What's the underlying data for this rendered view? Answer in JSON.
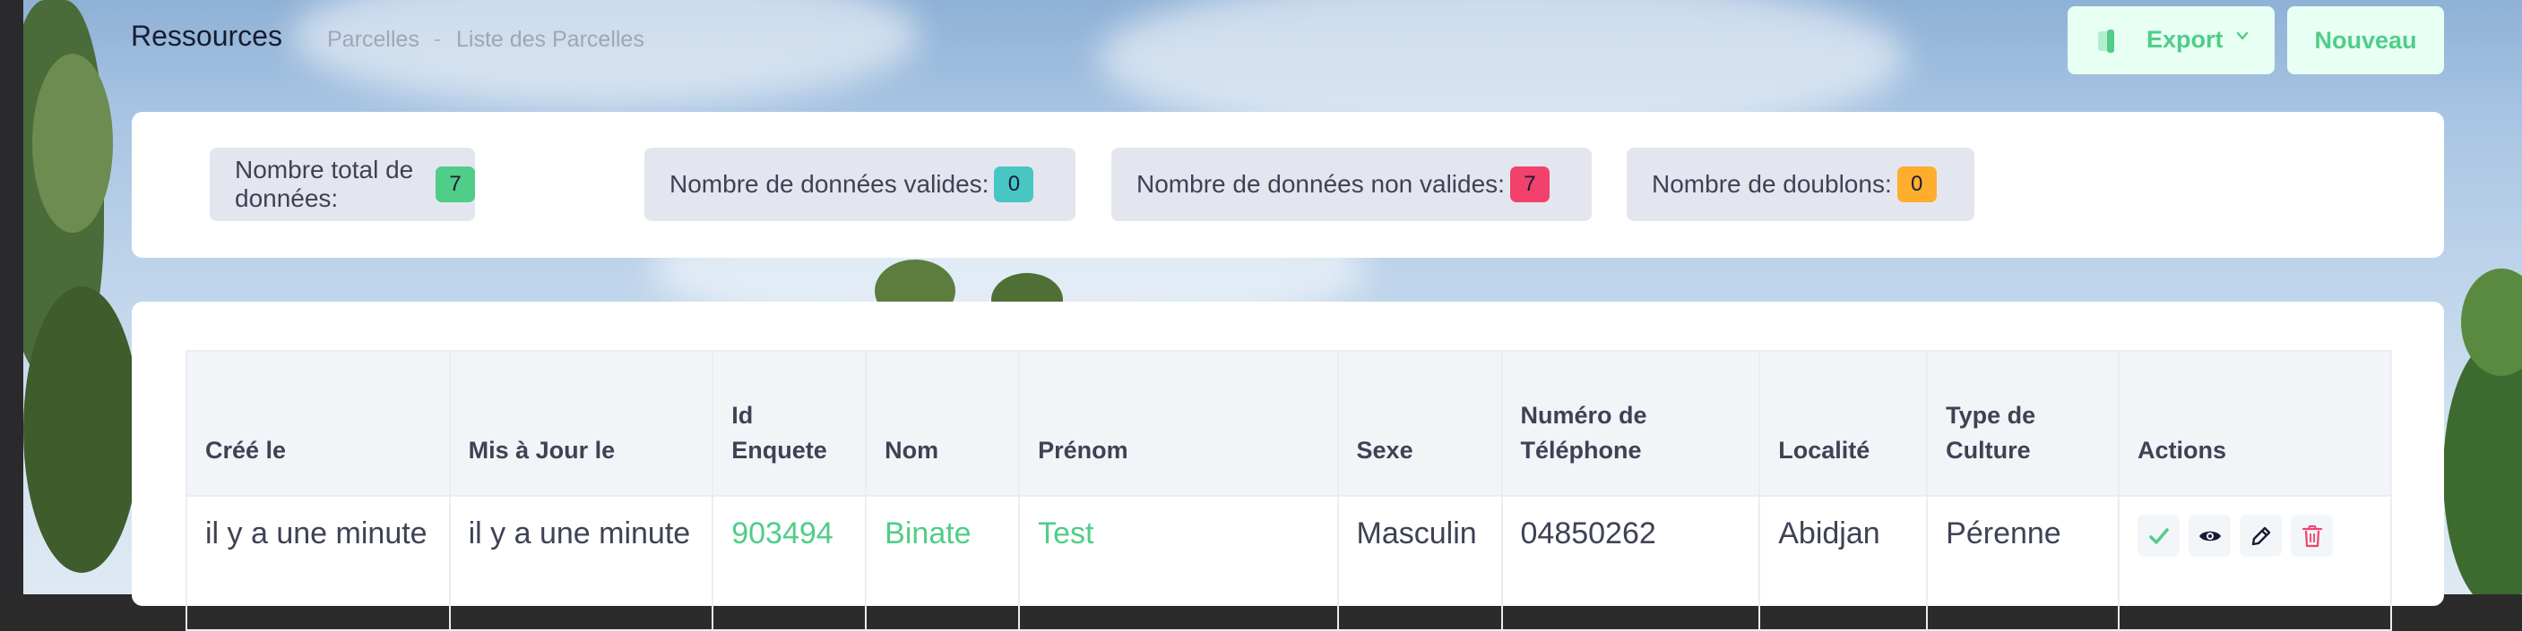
{
  "header": {
    "title": "Ressources",
    "breadcrumb": [
      "Parcelles",
      "Liste des Parcelles"
    ]
  },
  "toolbar": {
    "export_label": "Export",
    "new_label": "Nouveau",
    "export_icon": "export-file-icon",
    "dropdown_icon": "chevron-down-icon"
  },
  "stats": [
    {
      "label": "Nombre total de données:",
      "value": "7",
      "color": "#50cd89"
    },
    {
      "label": "Nombre de données valides:",
      "value": "0",
      "color": "#47c6c3"
    },
    {
      "label": "Nombre de données non valides:",
      "value": "7",
      "color": "#f1416c"
    },
    {
      "label": "Nombre de doublons:",
      "value": "0",
      "color": "#ffad2c"
    }
  ],
  "table": {
    "headers": [
      "Créé le",
      "Mis à Jour le",
      "Id Enquete",
      "Nom",
      "Prénom",
      "Sexe",
      "Numéro de Téléphone",
      "Localité",
      "Type de Culture",
      "Actions"
    ],
    "rows": [
      {
        "created": "il y a une minute",
        "updated": "il y a une minute",
        "id": "903494",
        "nom": "Binate",
        "prenom": "Test",
        "sexe": "Masculin",
        "telephone": "04850262",
        "localite": "Abidjan",
        "culture": "Pérenne",
        "actions": [
          "check-icon",
          "eye-icon",
          "pencil-icon",
          "trash-icon"
        ]
      }
    ]
  },
  "colors": {
    "accent": "#50cd89",
    "accent_light": "#e8fff3",
    "danger": "#f1416c"
  }
}
